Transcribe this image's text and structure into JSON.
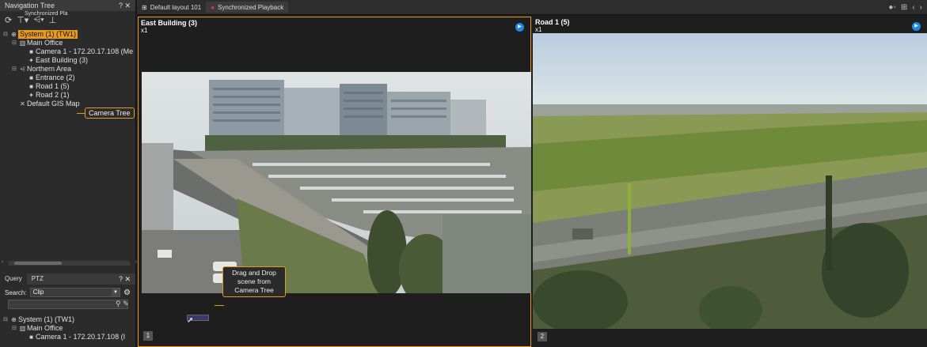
{
  "nav_panel": {
    "title": "Navigation Tree",
    "controls": "? ✕",
    "toolbar_tooltip": "Synchronized Pla"
  },
  "tree": [
    {
      "label": "System (1) (TW1)",
      "level": 0,
      "icon": "globe-icon",
      "expander": "⊟",
      "selected": true
    },
    {
      "label": "Main Office",
      "level": 1,
      "icon": "building-icon",
      "expander": "⊟",
      "selected": false
    },
    {
      "label": "Camera 1 - 172.20.17.108 (Me",
      "level": 2,
      "icon": "camera-icon",
      "expander": "",
      "selected": false
    },
    {
      "label": "East Building (3)",
      "level": 2,
      "icon": "scene-icon",
      "expander": "",
      "selected": false
    },
    {
      "label": "Northern Area",
      "level": 1,
      "icon": "share-icon",
      "expander": "⊟",
      "selected": false
    },
    {
      "label": "Entrance (2)",
      "level": 2,
      "icon": "camera-icon",
      "expander": "",
      "selected": false
    },
    {
      "label": "Road 1 (5)",
      "level": 2,
      "icon": "camera-icon",
      "expander": "",
      "selected": false
    },
    {
      "label": "Road 2 (1)",
      "level": 2,
      "icon": "scene-icon",
      "expander": "",
      "selected": false
    },
    {
      "label": "Default GIS Map",
      "level": 1,
      "icon": "map-icon",
      "expander": "",
      "selected": false
    }
  ],
  "callout_camera_tree": "Camera Tree",
  "query_panel": {
    "tabs": [
      "Query",
      "PTZ"
    ],
    "controls": "? ✕",
    "search_label": "Search:",
    "search_value": "Clip"
  },
  "query_tree": [
    {
      "label": "System (1) (TW1)",
      "level": 0
    },
    {
      "label": "Main Office",
      "level": 1
    },
    {
      "label": "Camera 1 - 172.20.17.108 (I",
      "level": 2
    }
  ],
  "tabs": [
    {
      "label": "Default layout 101",
      "icon": "layout-icon"
    },
    {
      "label": "Synchronized Playback",
      "icon": "sync-icon"
    }
  ],
  "views": [
    {
      "title": "East Building (3)",
      "zoom": "x1",
      "number": "1"
    },
    {
      "title": "Road 1 (5)",
      "zoom": "x1",
      "number": "2"
    }
  ],
  "callout_drag": "Drag and Drop scene from Camera Tree",
  "colors": {
    "accent": "#e89a1e",
    "play": "#1e88e5"
  }
}
